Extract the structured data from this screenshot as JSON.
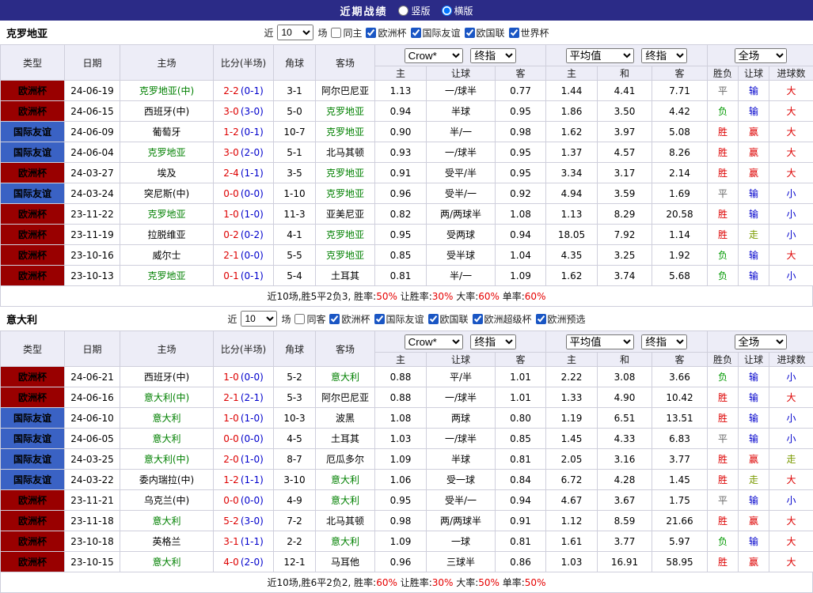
{
  "topbar": {
    "title": "近期战绩",
    "vertical_label": "竖版",
    "horizontal_label": "横版",
    "selected_layout": "横版"
  },
  "filter_labels": {
    "near": "近",
    "games": "场"
  },
  "controls": {
    "bookmaker": "Crow*",
    "final_odds": "终指",
    "average": "平均值",
    "full_match": "全场"
  },
  "cols": {
    "type": "类型",
    "date": "日期",
    "home": "主场",
    "score": "比分(半场)",
    "corner": "角球",
    "away": "客场",
    "ah_home": "主",
    "ah_line": "让球",
    "ah_away": "客",
    "eu_home": "主",
    "eu_draw": "和",
    "eu_away": "客",
    "wdl": "胜负",
    "ah_res": "让球",
    "goals": "进球数"
  },
  "colors": {
    "topbar_bg": "#2B2B87",
    "header_bg": "#EDEDF7",
    "border": "#CFCFDC",
    "team_focus": "#008000",
    "score_ft": "#DD0000",
    "score_ht": "#0000CC",
    "stat": "#E60000",
    "league_colors": {
      "欧洲杯": "#990000",
      "国际友谊": "#3A62C4"
    },
    "palette": {
      "red": "#DD0000",
      "blue": "#0000CC",
      "green": "#009900",
      "olive": "#7A9A00",
      "gray": "#666666"
    }
  },
  "sections": [
    {
      "team": "克罗地亚",
      "filter": {
        "count": "10",
        "same_label": "同主",
        "same_checked": false,
        "leagues": [
          "欧洲杯",
          "国际友谊",
          "欧国联",
          "世界杯"
        ]
      },
      "rows": [
        {
          "lg": "欧洲杯",
          "date": "24-06-19",
          "home": "克罗地亚(中)",
          "hf": true,
          "ft": "2-2",
          "ht": "(0-1)",
          "cor": "3-1",
          "away": "阿尔巴尼亚",
          "af": false,
          "ah": [
            "1.13",
            "一/球半",
            "0.77"
          ],
          "eu": [
            "1.44",
            "4.41",
            "7.71"
          ],
          "res": [
            [
              "平",
              "gray"
            ],
            [
              "输",
              "blue"
            ],
            [
              "大",
              "red"
            ]
          ]
        },
        {
          "lg": "欧洲杯",
          "date": "24-06-15",
          "home": "西班牙(中)",
          "hf": false,
          "ft": "3-0",
          "ht": "(3-0)",
          "cor": "5-0",
          "away": "克罗地亚",
          "af": true,
          "ah": [
            "0.94",
            "半球",
            "0.95"
          ],
          "eu": [
            "1.86",
            "3.50",
            "4.42"
          ],
          "res": [
            [
              "负",
              "green"
            ],
            [
              "输",
              "blue"
            ],
            [
              "大",
              "red"
            ]
          ]
        },
        {
          "lg": "国际友谊",
          "date": "24-06-09",
          "home": "葡萄牙",
          "hf": false,
          "ft": "1-2",
          "ht": "(0-1)",
          "cor": "10-7",
          "away": "克罗地亚",
          "af": true,
          "ah": [
            "0.90",
            "半/一",
            "0.98"
          ],
          "eu": [
            "1.62",
            "3.97",
            "5.08"
          ],
          "res": [
            [
              "胜",
              "red"
            ],
            [
              "赢",
              "red"
            ],
            [
              "大",
              "red"
            ]
          ]
        },
        {
          "lg": "国际友谊",
          "date": "24-06-04",
          "home": "克罗地亚",
          "hf": true,
          "ft": "3-0",
          "ht": "(2-0)",
          "cor": "5-1",
          "away": "北马其顿",
          "af": false,
          "ah": [
            "0.93",
            "一/球半",
            "0.95"
          ],
          "eu": [
            "1.37",
            "4.57",
            "8.26"
          ],
          "res": [
            [
              "胜",
              "red"
            ],
            [
              "赢",
              "red"
            ],
            [
              "大",
              "red"
            ]
          ]
        },
        {
          "lg": "欧洲杯",
          "date": "24-03-27",
          "home": "埃及",
          "hf": false,
          "ft": "2-4",
          "ht": "(1-1)",
          "cor": "3-5",
          "away": "克罗地亚",
          "af": true,
          "ah": [
            "0.91",
            "受平/半",
            "0.95"
          ],
          "eu": [
            "3.34",
            "3.17",
            "2.14"
          ],
          "res": [
            [
              "胜",
              "red"
            ],
            [
              "赢",
              "red"
            ],
            [
              "大",
              "red"
            ]
          ]
        },
        {
          "lg": "国际友谊",
          "date": "24-03-24",
          "home": "突尼斯(中)",
          "hf": false,
          "ft": "0-0",
          "ht": "(0-0)",
          "cor": "1-10",
          "away": "克罗地亚",
          "af": true,
          "ah": [
            "0.96",
            "受半/一",
            "0.92"
          ],
          "eu": [
            "4.94",
            "3.59",
            "1.69"
          ],
          "res": [
            [
              "平",
              "gray"
            ],
            [
              "输",
              "blue"
            ],
            [
              "小",
              "blue"
            ]
          ]
        },
        {
          "lg": "欧洲杯",
          "date": "23-11-22",
          "home": "克罗地亚",
          "hf": true,
          "ft": "1-0",
          "ht": "(1-0)",
          "cor": "11-3",
          "away": "亚美尼亚",
          "af": false,
          "ah": [
            "0.82",
            "两/两球半",
            "1.08"
          ],
          "eu": [
            "1.13",
            "8.29",
            "20.58"
          ],
          "res": [
            [
              "胜",
              "red"
            ],
            [
              "输",
              "blue"
            ],
            [
              "小",
              "blue"
            ]
          ]
        },
        {
          "lg": "欧洲杯",
          "date": "23-11-19",
          "home": "拉脱维亚",
          "hf": false,
          "ft": "0-2",
          "ht": "(0-2)",
          "cor": "4-1",
          "away": "克罗地亚",
          "af": true,
          "ah": [
            "0.95",
            "受两球",
            "0.94"
          ],
          "eu": [
            "18.05",
            "7.92",
            "1.14"
          ],
          "res": [
            [
              "胜",
              "red"
            ],
            [
              "走",
              "olive"
            ],
            [
              "小",
              "blue"
            ]
          ]
        },
        {
          "lg": "欧洲杯",
          "date": "23-10-16",
          "home": "威尔士",
          "hf": false,
          "ft": "2-1",
          "ht": "(0-0)",
          "cor": "5-5",
          "away": "克罗地亚",
          "af": true,
          "ah": [
            "0.85",
            "受半球",
            "1.04"
          ],
          "eu": [
            "4.35",
            "3.25",
            "1.92"
          ],
          "res": [
            [
              "负",
              "green"
            ],
            [
              "输",
              "blue"
            ],
            [
              "大",
              "red"
            ]
          ]
        },
        {
          "lg": "欧洲杯",
          "date": "23-10-13",
          "home": "克罗地亚",
          "hf": true,
          "ft": "0-1",
          "ht": "(0-1)",
          "cor": "5-4",
          "away": "土耳其",
          "af": false,
          "ah": [
            "0.81",
            "半/一",
            "1.09"
          ],
          "eu": [
            "1.62",
            "3.74",
            "5.68"
          ],
          "res": [
            [
              "负",
              "green"
            ],
            [
              "输",
              "blue"
            ],
            [
              "小",
              "blue"
            ]
          ]
        }
      ],
      "summary": [
        {
          "t": "近10场,胜5平2负3, 胜率:",
          "c": "k"
        },
        {
          "t": "50%",
          "c": "r"
        },
        {
          "t": " 让胜率:",
          "c": "k"
        },
        {
          "t": "30%",
          "c": "r"
        },
        {
          "t": " 大率:",
          "c": "k"
        },
        {
          "t": "60%",
          "c": "r"
        },
        {
          "t": " 单率:",
          "c": "k"
        },
        {
          "t": "60%",
          "c": "r"
        }
      ]
    },
    {
      "team": "意大利",
      "filter": {
        "count": "10",
        "same_label": "同客",
        "same_checked": false,
        "leagues": [
          "欧洲杯",
          "国际友谊",
          "欧国联",
          "欧洲超级杯",
          "欧洲预选"
        ]
      },
      "rows": [
        {
          "lg": "欧洲杯",
          "date": "24-06-21",
          "home": "西班牙(中)",
          "hf": false,
          "ft": "1-0",
          "ht": "(0-0)",
          "cor": "5-2",
          "away": "意大利",
          "af": true,
          "ah": [
            "0.88",
            "平/半",
            "1.01"
          ],
          "eu": [
            "2.22",
            "3.08",
            "3.66"
          ],
          "res": [
            [
              "负",
              "green"
            ],
            [
              "输",
              "blue"
            ],
            [
              "小",
              "blue"
            ]
          ]
        },
        {
          "lg": "欧洲杯",
          "date": "24-06-16",
          "home": "意大利(中)",
          "hf": true,
          "ft": "2-1",
          "ht": "(2-1)",
          "cor": "5-3",
          "away": "阿尔巴尼亚",
          "af": false,
          "ah": [
            "0.88",
            "一/球半",
            "1.01"
          ],
          "eu": [
            "1.33",
            "4.90",
            "10.42"
          ],
          "res": [
            [
              "胜",
              "red"
            ],
            [
              "输",
              "blue"
            ],
            [
              "大",
              "red"
            ]
          ]
        },
        {
          "lg": "国际友谊",
          "date": "24-06-10",
          "home": "意大利",
          "hf": true,
          "ft": "1-0",
          "ht": "(1-0)",
          "cor": "10-3",
          "away": "波黑",
          "af": false,
          "ah": [
            "1.08",
            "两球",
            "0.80"
          ],
          "eu": [
            "1.19",
            "6.51",
            "13.51"
          ],
          "res": [
            [
              "胜",
              "red"
            ],
            [
              "输",
              "blue"
            ],
            [
              "小",
              "blue"
            ]
          ]
        },
        {
          "lg": "国际友谊",
          "date": "24-06-05",
          "home": "意大利",
          "hf": true,
          "ft": "0-0",
          "ht": "(0-0)",
          "cor": "4-5",
          "away": "土耳其",
          "af": false,
          "ah": [
            "1.03",
            "一/球半",
            "0.85"
          ],
          "eu": [
            "1.45",
            "4.33",
            "6.83"
          ],
          "res": [
            [
              "平",
              "gray"
            ],
            [
              "输",
              "blue"
            ],
            [
              "小",
              "blue"
            ]
          ]
        },
        {
          "lg": "国际友谊",
          "date": "24-03-25",
          "home": "意大利(中)",
          "hf": true,
          "ft": "2-0",
          "ht": "(1-0)",
          "cor": "8-7",
          "away": "厄瓜多尔",
          "af": false,
          "ah": [
            "1.09",
            "半球",
            "0.81"
          ],
          "eu": [
            "2.05",
            "3.16",
            "3.77"
          ],
          "res": [
            [
              "胜",
              "red"
            ],
            [
              "赢",
              "red"
            ],
            [
              "走",
              "olive"
            ]
          ]
        },
        {
          "lg": "国际友谊",
          "date": "24-03-22",
          "home": "委内瑞拉(中)",
          "hf": false,
          "ft": "1-2",
          "ht": "(1-1)",
          "cor": "3-10",
          "away": "意大利",
          "af": true,
          "ah": [
            "1.06",
            "受一球",
            "0.84"
          ],
          "eu": [
            "6.72",
            "4.28",
            "1.45"
          ],
          "res": [
            [
              "胜",
              "red"
            ],
            [
              "走",
              "olive"
            ],
            [
              "大",
              "red"
            ]
          ]
        },
        {
          "lg": "欧洲杯",
          "date": "23-11-21",
          "home": "乌克兰(中)",
          "hf": false,
          "ft": "0-0",
          "ht": "(0-0)",
          "cor": "4-9",
          "away": "意大利",
          "af": true,
          "ah": [
            "0.95",
            "受半/一",
            "0.94"
          ],
          "eu": [
            "4.67",
            "3.67",
            "1.75"
          ],
          "res": [
            [
              "平",
              "gray"
            ],
            [
              "输",
              "blue"
            ],
            [
              "小",
              "blue"
            ]
          ]
        },
        {
          "lg": "欧洲杯",
          "date": "23-11-18",
          "home": "意大利",
          "hf": true,
          "ft": "5-2",
          "ht": "(3-0)",
          "cor": "7-2",
          "away": "北马其顿",
          "af": false,
          "ah": [
            "0.98",
            "两/两球半",
            "0.91"
          ],
          "eu": [
            "1.12",
            "8.59",
            "21.66"
          ],
          "res": [
            [
              "胜",
              "red"
            ],
            [
              "赢",
              "red"
            ],
            [
              "大",
              "red"
            ]
          ]
        },
        {
          "lg": "欧洲杯",
          "date": "23-10-18",
          "home": "英格兰",
          "hf": false,
          "ft": "3-1",
          "ht": "(1-1)",
          "cor": "2-2",
          "away": "意大利",
          "af": true,
          "ah": [
            "1.09",
            "一球",
            "0.81"
          ],
          "eu": [
            "1.61",
            "3.77",
            "5.97"
          ],
          "res": [
            [
              "负",
              "green"
            ],
            [
              "输",
              "blue"
            ],
            [
              "大",
              "red"
            ]
          ]
        },
        {
          "lg": "欧洲杯",
          "date": "23-10-15",
          "home": "意大利",
          "hf": true,
          "ft": "4-0",
          "ht": "(2-0)",
          "cor": "12-1",
          "away": "马耳他",
          "af": false,
          "ah": [
            "0.96",
            "三球半",
            "0.86"
          ],
          "eu": [
            "1.03",
            "16.91",
            "58.95"
          ],
          "res": [
            [
              "胜",
              "red"
            ],
            [
              "赢",
              "red"
            ],
            [
              "大",
              "red"
            ]
          ]
        }
      ],
      "summary": [
        {
          "t": "近10场,胜6平2负2, 胜率:",
          "c": "k"
        },
        {
          "t": "60%",
          "c": "r"
        },
        {
          "t": " 让胜率:",
          "c": "k"
        },
        {
          "t": "30%",
          "c": "r"
        },
        {
          "t": " 大率:",
          "c": "k"
        },
        {
          "t": "50%",
          "c": "r"
        },
        {
          "t": " 单率:",
          "c": "k"
        },
        {
          "t": "50%",
          "c": "r"
        }
      ]
    }
  ]
}
